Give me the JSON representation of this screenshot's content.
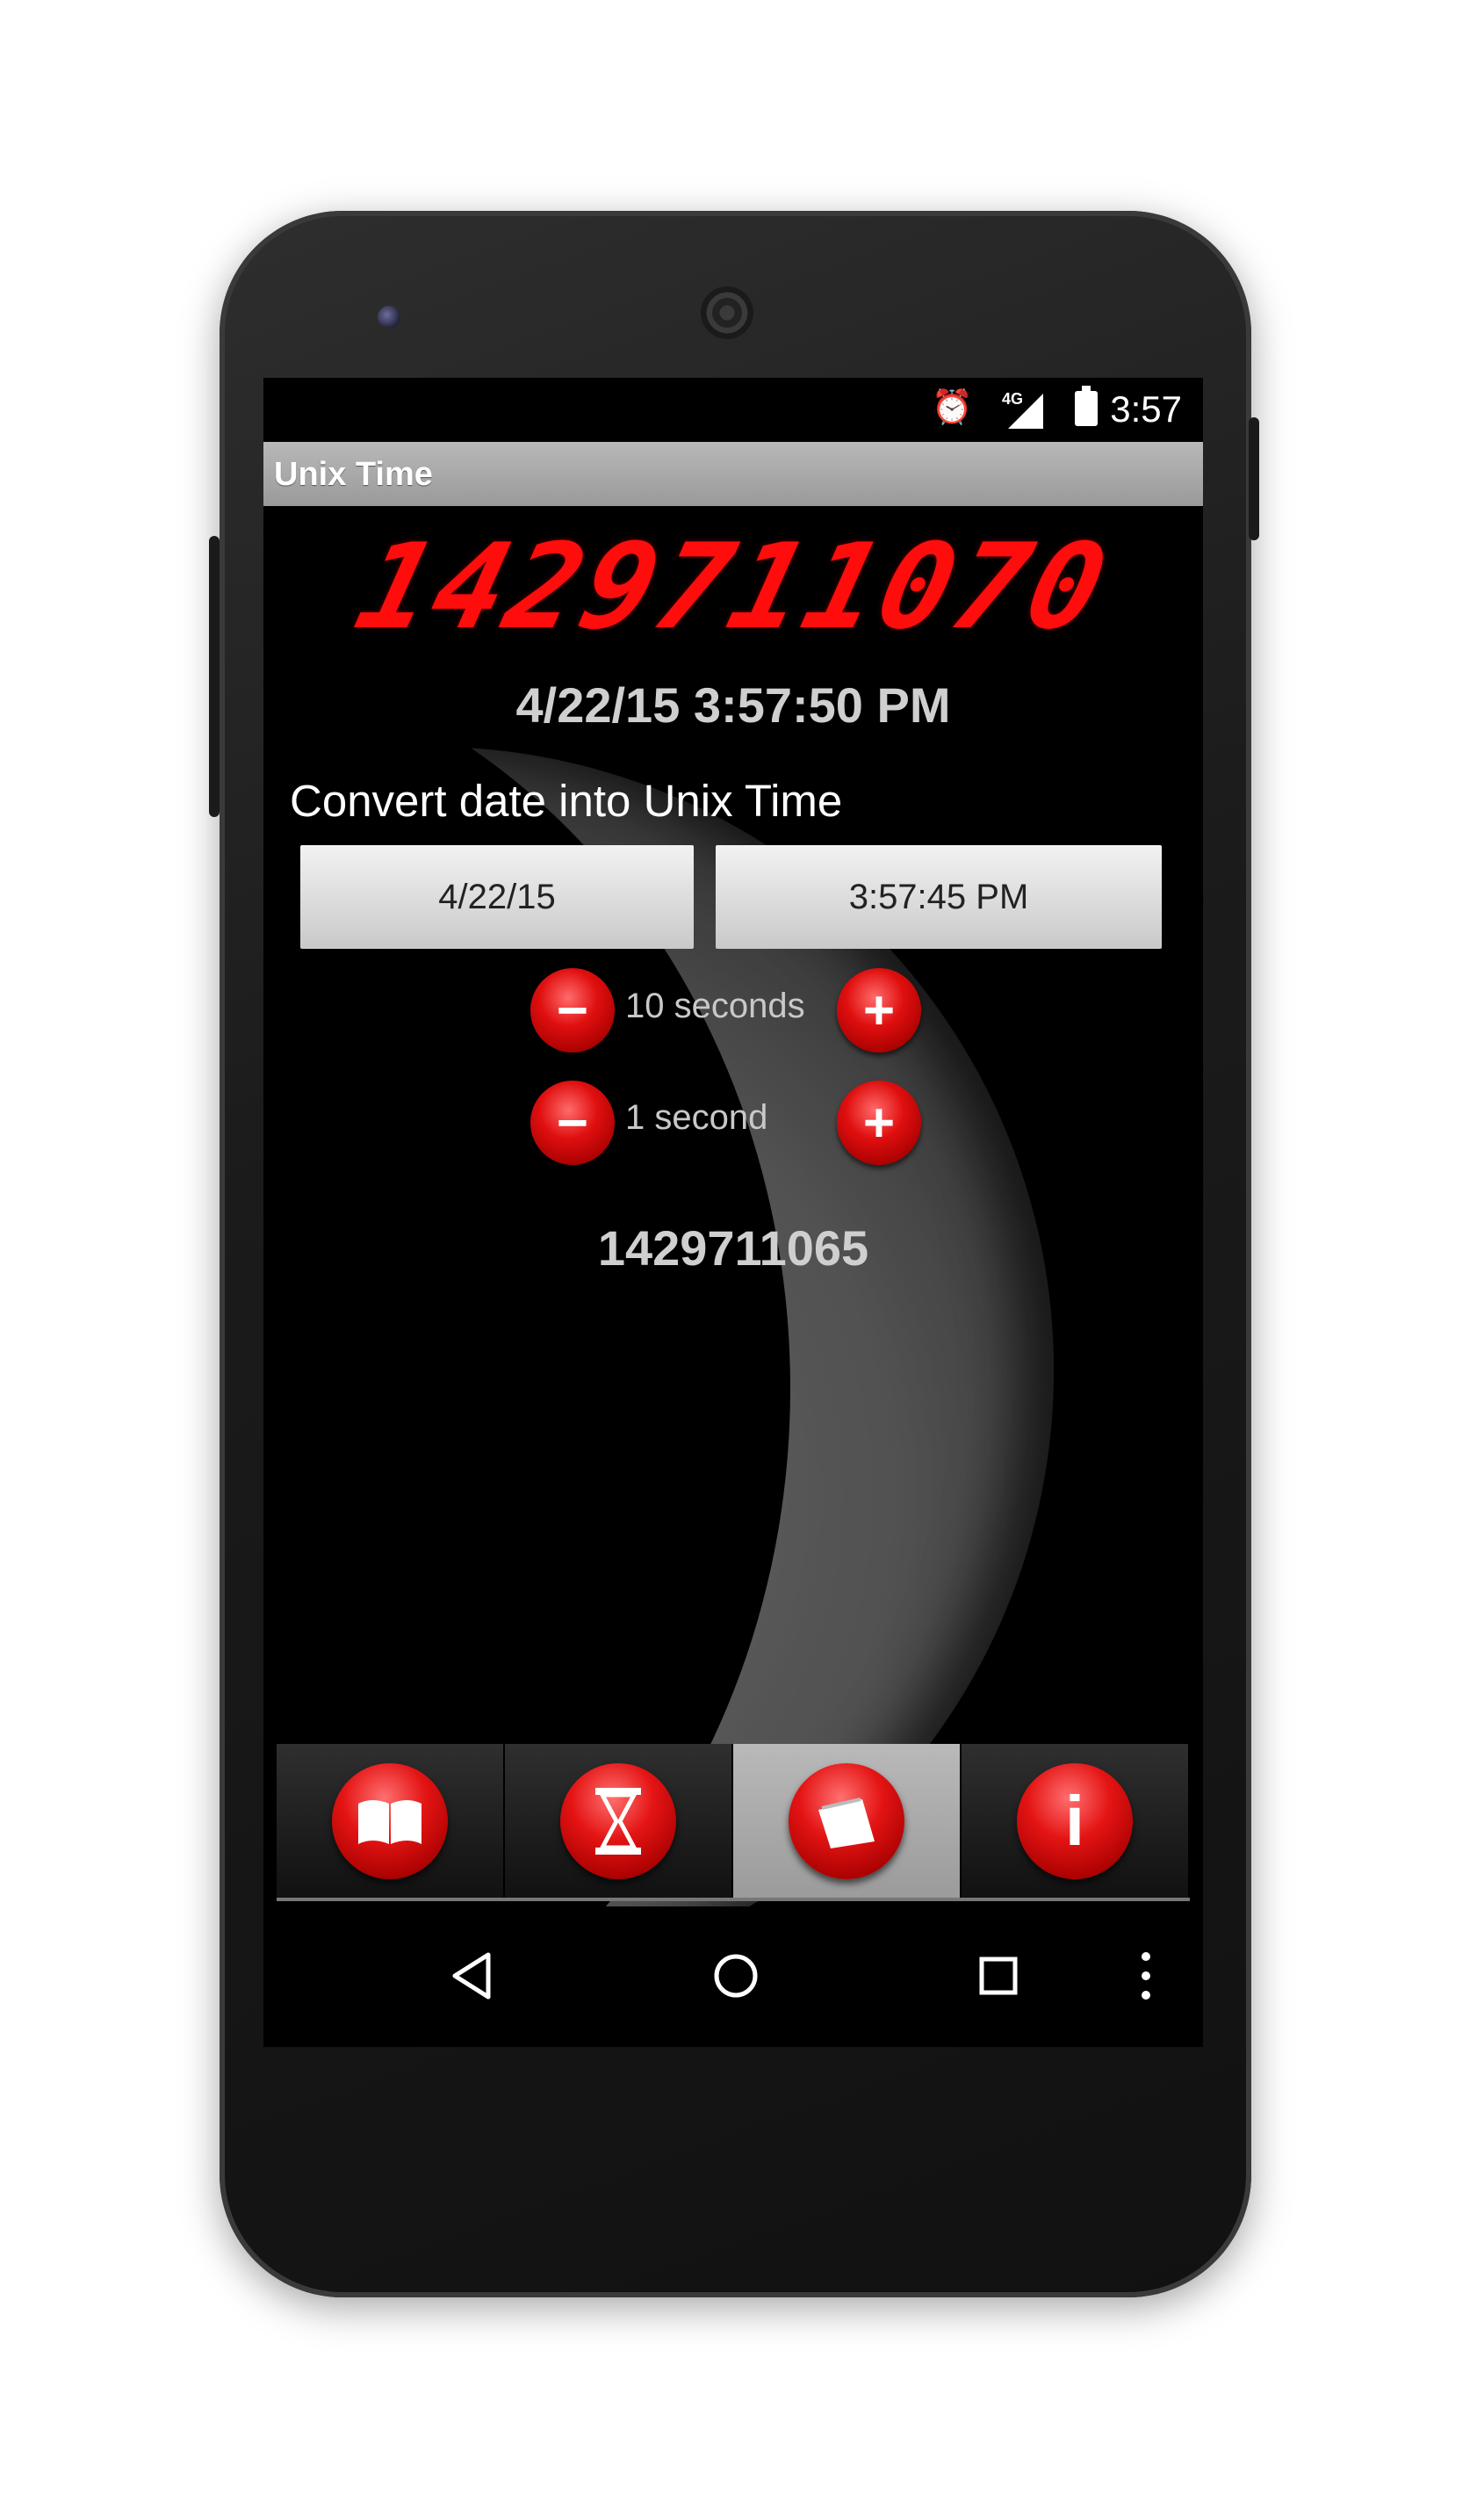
{
  "status_bar": {
    "time": "3:57",
    "network": "4G",
    "icons": [
      "alarm-icon",
      "signal-icon",
      "battery-icon"
    ]
  },
  "app": {
    "title": "Unix Time"
  },
  "current": {
    "unix_time": "1429711070",
    "datetime": "4/22/15 3:57:50 PM"
  },
  "converter": {
    "label": "Convert date into Unix Time",
    "date": "4/22/15",
    "time": "3:57:45 PM",
    "steps": [
      {
        "label": "10 seconds",
        "minus": "−",
        "plus": "+"
      },
      {
        "label": "1 second",
        "minus": "−",
        "plus": "+"
      }
    ],
    "result": "1429711065"
  },
  "tabs": [
    {
      "name": "book-icon",
      "active": false
    },
    {
      "name": "hourglass-icon",
      "active": false
    },
    {
      "name": "calendar-icon",
      "active": true
    },
    {
      "name": "info-icon",
      "active": false
    }
  ],
  "tab_glyphs": {
    "info": "i"
  },
  "colors": {
    "led": "#ff0d0d",
    "accent_button": "#e00f0f",
    "title_bar": "#a8a8a8"
  },
  "nav": [
    "back-icon",
    "home-icon",
    "recent-apps-icon",
    "more-icon"
  ]
}
